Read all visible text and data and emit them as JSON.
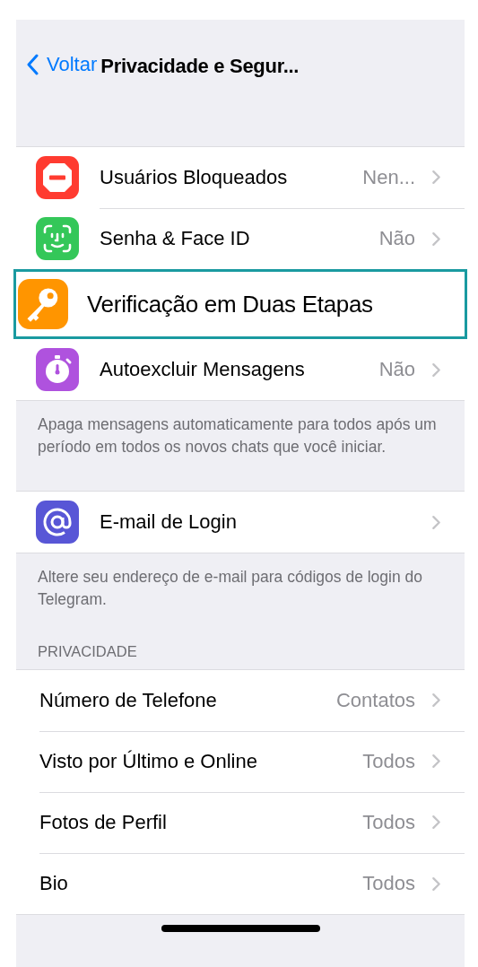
{
  "nav": {
    "back": "Voltar",
    "title": "Privacidade e Segur..."
  },
  "security": {
    "items": [
      {
        "kind": "blocked",
        "label": "Usuários Bloqueados",
        "value": "Nen...",
        "highlighted": false
      },
      {
        "kind": "faceid",
        "label": "Senha & Face ID",
        "value": "Não",
        "highlighted": false
      },
      {
        "kind": "key",
        "label": "Verificação em Duas Etapas",
        "highlighted": true
      },
      {
        "kind": "timer",
        "label": "Autoexcluir Mensagens",
        "value": "Não",
        "highlighted": false
      }
    ],
    "footer": "Apaga mensagens automaticamente para todos após um período em todos os novos chats que você iniciar."
  },
  "login": {
    "items": [
      {
        "kind": "at",
        "label": "E-mail de Login",
        "highlighted": false
      }
    ],
    "footer": "Altere seu endereço de e-mail para códigos de login do Telegram."
  },
  "privacy": {
    "header": "PRIVACIDADE",
    "items": [
      {
        "label": "Número de Telefone",
        "value": "Contatos"
      },
      {
        "label": "Visto por Último e Online",
        "value": "Todos"
      },
      {
        "label": "Fotos de Perfil",
        "value": "Todos"
      },
      {
        "label": "Bio",
        "value": "Todos"
      }
    ]
  }
}
